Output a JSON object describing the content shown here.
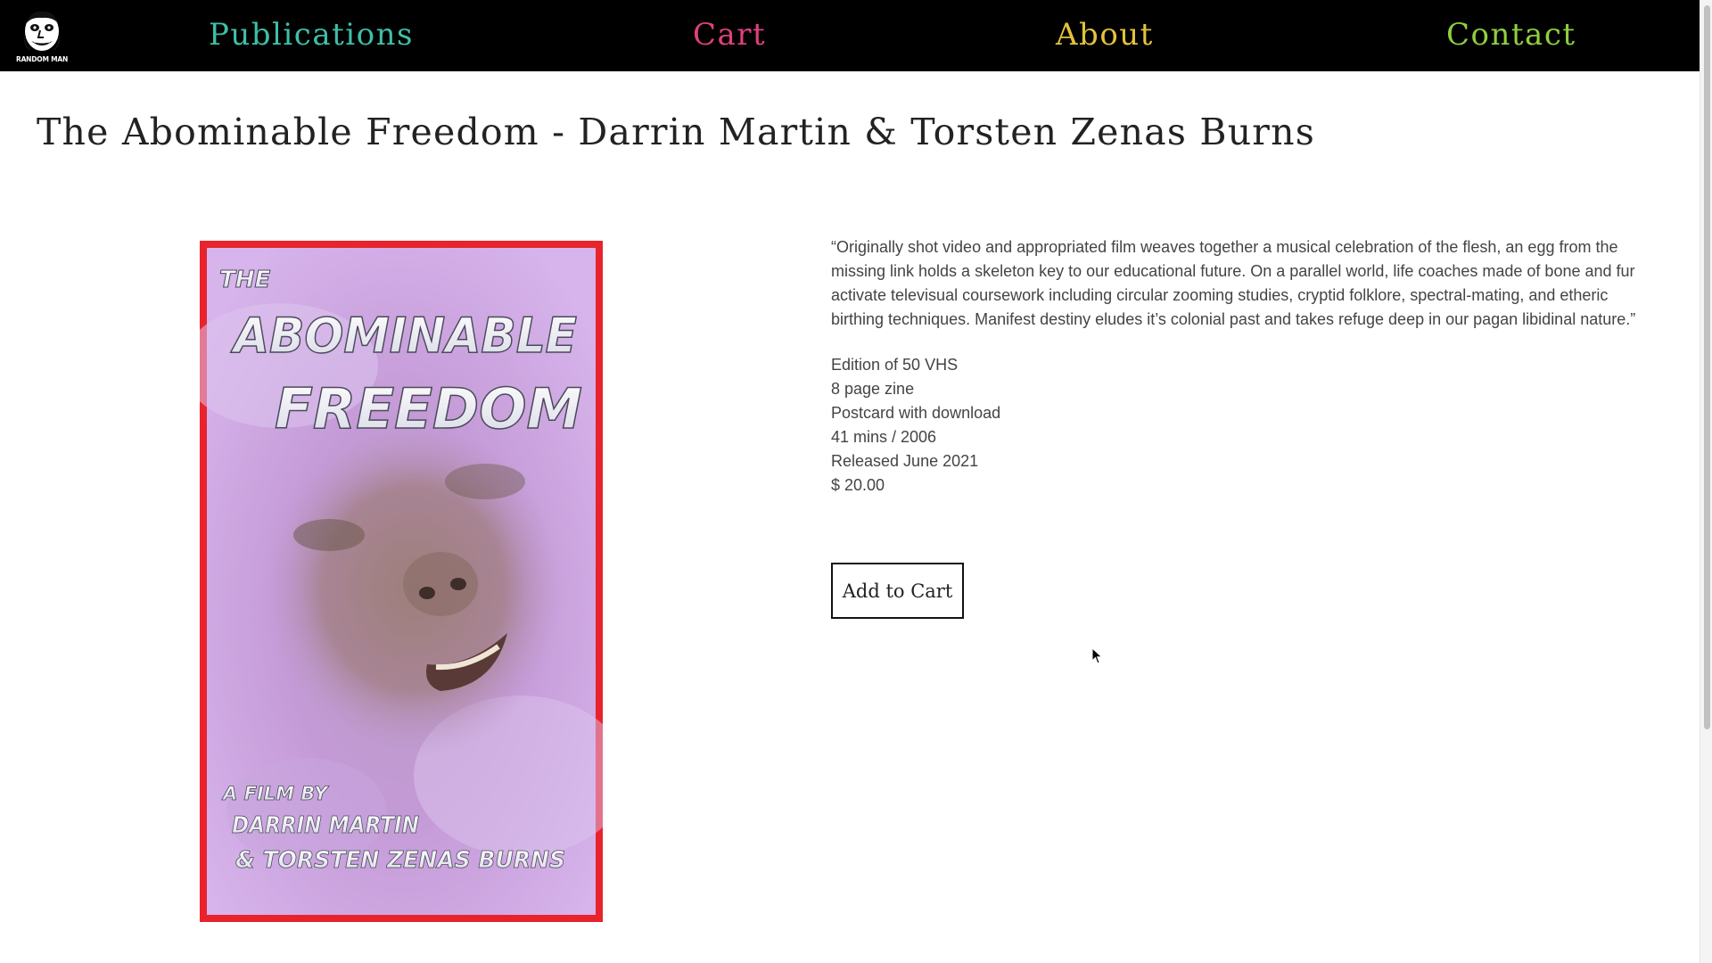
{
  "nav": {
    "logo_text": "RANDOM MAN",
    "links": [
      {
        "label": "Publications",
        "color": "#3fbfa8"
      },
      {
        "label": "Cart",
        "color": "#e0407f"
      },
      {
        "label": "About",
        "color": "#e3c23a"
      },
      {
        "label": "Contact",
        "color": "#8fcf3e"
      }
    ]
  },
  "product": {
    "title": "The Abominable Freedom - Darrin Martin & Torsten Zenas Burns",
    "description": "“Originally shot video and appropriated film weaves together a musical celebration of the flesh, an egg from the missing link holds a skeleton key to our educational future. On a parallel world, life coaches made of bone and fur activate televisual coursework including circular zooming studies, cryptid folklore, spectral-mating, and etheric birthing techniques. Manifest destiny eludes it’s colonial past and takes refuge deep in our pagan libidinal nature.”",
    "specs": [
      "Edition of 50 VHS",
      "8 page zine",
      "Postcard with download",
      "41 mins / 2006",
      "Released June 2021",
      "$ 20.00"
    ],
    "add_to_cart_label": "Add to Cart",
    "cover": {
      "line1": "THE",
      "line2": "ABOMINABLE",
      "line3": "FREEDOM",
      "credit1": "A FILM BY",
      "credit2": "DARRIN MARTIN",
      "credit3": "& TORSTEN ZENAS BURNS",
      "border_color": "#e8232c"
    }
  }
}
